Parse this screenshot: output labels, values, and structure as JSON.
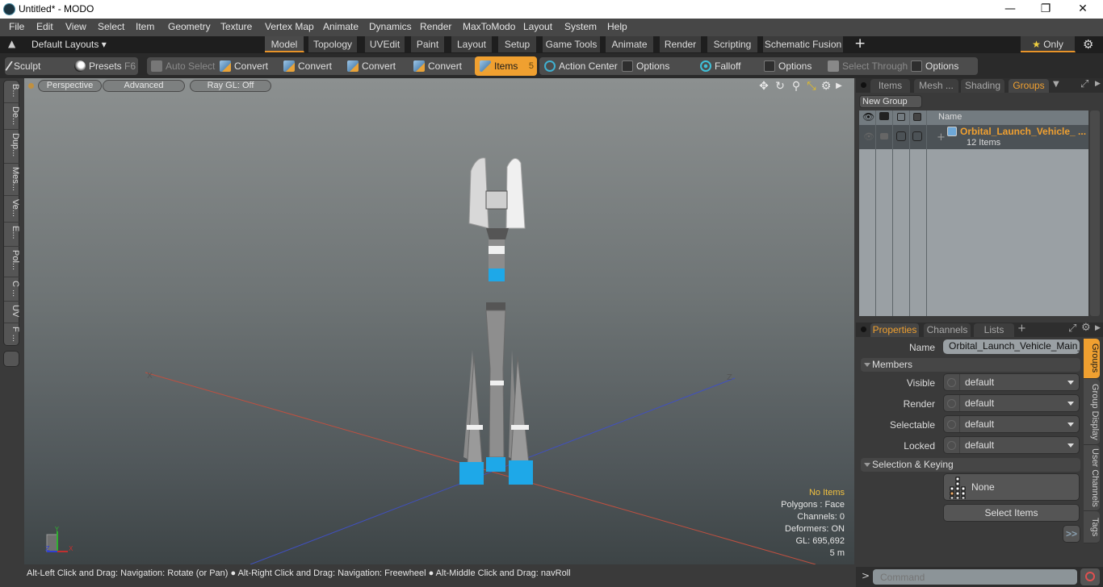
{
  "window": {
    "title": "Untitled* - MODO",
    "minimize": "—",
    "restore": "❐",
    "close": "✕"
  },
  "menu": [
    "File",
    "Edit",
    "View",
    "Select",
    "Item",
    "Geometry",
    "Texture",
    "Vertex Map",
    "Animate",
    "Dynamics",
    "Render",
    "MaxToModo",
    "Layout",
    "System",
    "Help"
  ],
  "layouts": {
    "selector": "Default Layouts",
    "tabs": [
      "Model",
      "Topology",
      "UVEdit",
      "Paint",
      "Layout",
      "Setup",
      "Game Tools",
      "Animate",
      "Render",
      "Scripting",
      "Schematic Fusion"
    ],
    "active_tab": "Model",
    "add": "+",
    "only": "Only",
    "star": "★"
  },
  "toolbar": {
    "sculpt": "Sculpt",
    "presets": "Presets",
    "presets_key": "F6",
    "auto_select": "Auto Select",
    "convert1": "Convert",
    "convert2": "Convert",
    "convert3": "Convert",
    "convert4": "Convert",
    "items": "Items",
    "items_key": "5",
    "action_center": "Action Center",
    "options1": "Options",
    "falloff": "Falloff",
    "options2": "Options",
    "select_through": "Select Through",
    "options3": "Options"
  },
  "left_tabs": [
    "B...",
    "De...",
    "Dup...",
    "Mes...",
    "Ve...",
    "E...",
    "Pol...",
    "C ...",
    "UV",
    "F ..."
  ],
  "viewport": {
    "view_mode": "Perspective",
    "shading": "Advanced",
    "raygl": "Ray GL: Off",
    "axis_labels": {
      "x_neg": "X",
      "z_neg": "Z"
    },
    "gizmo": {
      "x": "X",
      "y": "Y",
      "z": "Z"
    },
    "stats": {
      "selection": "No Items",
      "polygons": "Polygons : Face",
      "channels": "Channels: 0",
      "deformers": "Deformers: ON",
      "gl": "GL: 695,692",
      "scale": "5 m"
    }
  },
  "statusbar": {
    "hint": "Alt-Left Click and Drag: Navigation: Rotate (or Pan) ● Alt-Right Click and Drag: Navigation: Freewheel ● Alt-Middle Click and Drag: navRoll"
  },
  "groups_panel": {
    "tabs": [
      "Items",
      "Mesh ...",
      "Shading",
      "Groups"
    ],
    "active_tab": "Groups",
    "new_group": "New Group",
    "columns": {
      "name": "Name"
    },
    "rows": [
      {
        "name": "Orbital_Launch_Vehicle_ ...",
        "count": "12 Items",
        "expand": "+"
      }
    ]
  },
  "properties_panel": {
    "tabs": [
      "Properties",
      "Channels",
      "Lists"
    ],
    "active_tab": "Properties",
    "add": "+",
    "name_label": "Name",
    "name_value": "Orbital_Launch_Vehicle_Main_Pai",
    "members_section": "Members",
    "fields": [
      {
        "label": "Visible",
        "value": "default"
      },
      {
        "label": "Render",
        "value": "default"
      },
      {
        "label": "Selectable",
        "value": "default"
      },
      {
        "label": "Locked",
        "value": "default"
      }
    ],
    "selection_section": "Selection & Keying",
    "none_button": "None",
    "select_items_button": "Select Items",
    "more_button": ">>",
    "side_tabs": [
      "Groups",
      "Group Display",
      "User Channels",
      "Tags"
    ],
    "active_side_tab": "Groups"
  },
  "command": {
    "prompt": ">",
    "placeholder": "Command"
  },
  "colors": {
    "accent": "#f0a030",
    "highlight_text": "#f0c040",
    "model_blue": "#1ea8e8"
  }
}
